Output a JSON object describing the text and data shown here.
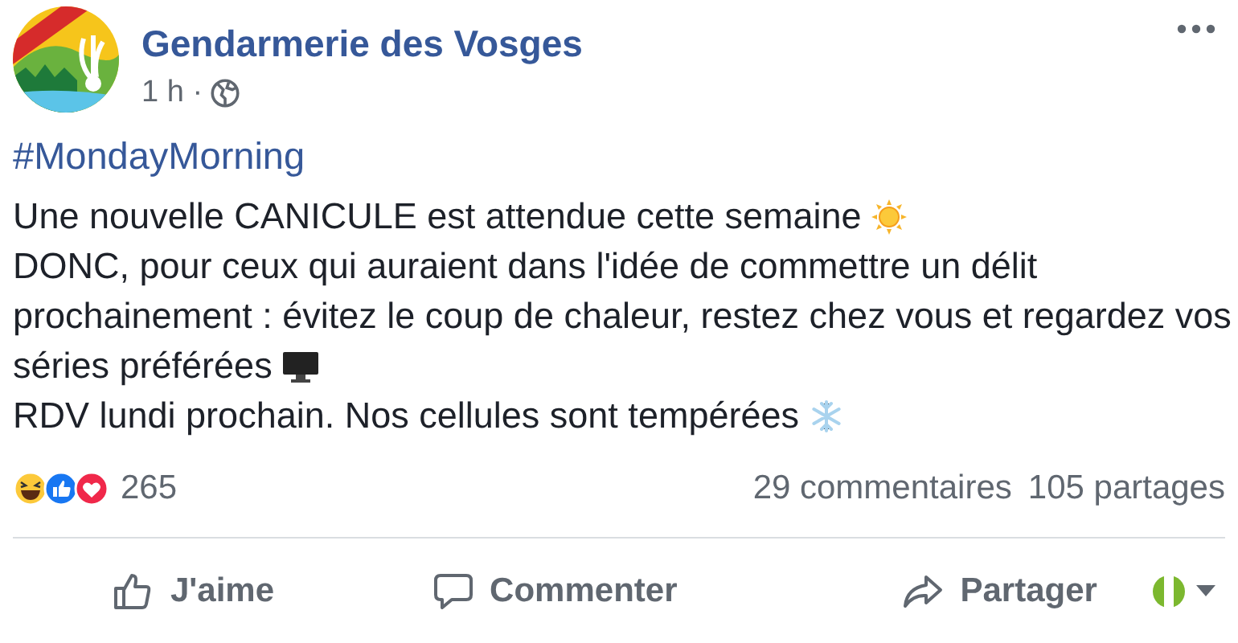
{
  "page": {
    "name": "Gendarmerie des Vosges",
    "time": "1 h ·"
  },
  "hashtag": "#MondayMorning",
  "body": [
    "Une nouvelle CANICULE est attendue cette semaine",
    "DONC, pour ceux qui auraient dans l'idée de commettre un délit",
    "prochainement : évitez le coup de chaleur, restez chez vous et regardez vos",
    "séries préférées",
    "RDV lundi prochain. Nos cellules sont tempérées"
  ],
  "reactions": {
    "count": "265"
  },
  "comments": "29 commentaires",
  "shares": "105 partages",
  "actions": [
    {
      "kind": "like",
      "label": "J'aime"
    },
    {
      "kind": "comment",
      "label": "Commenter"
    },
    {
      "kind": "share",
      "label": "Partager"
    }
  ]
}
